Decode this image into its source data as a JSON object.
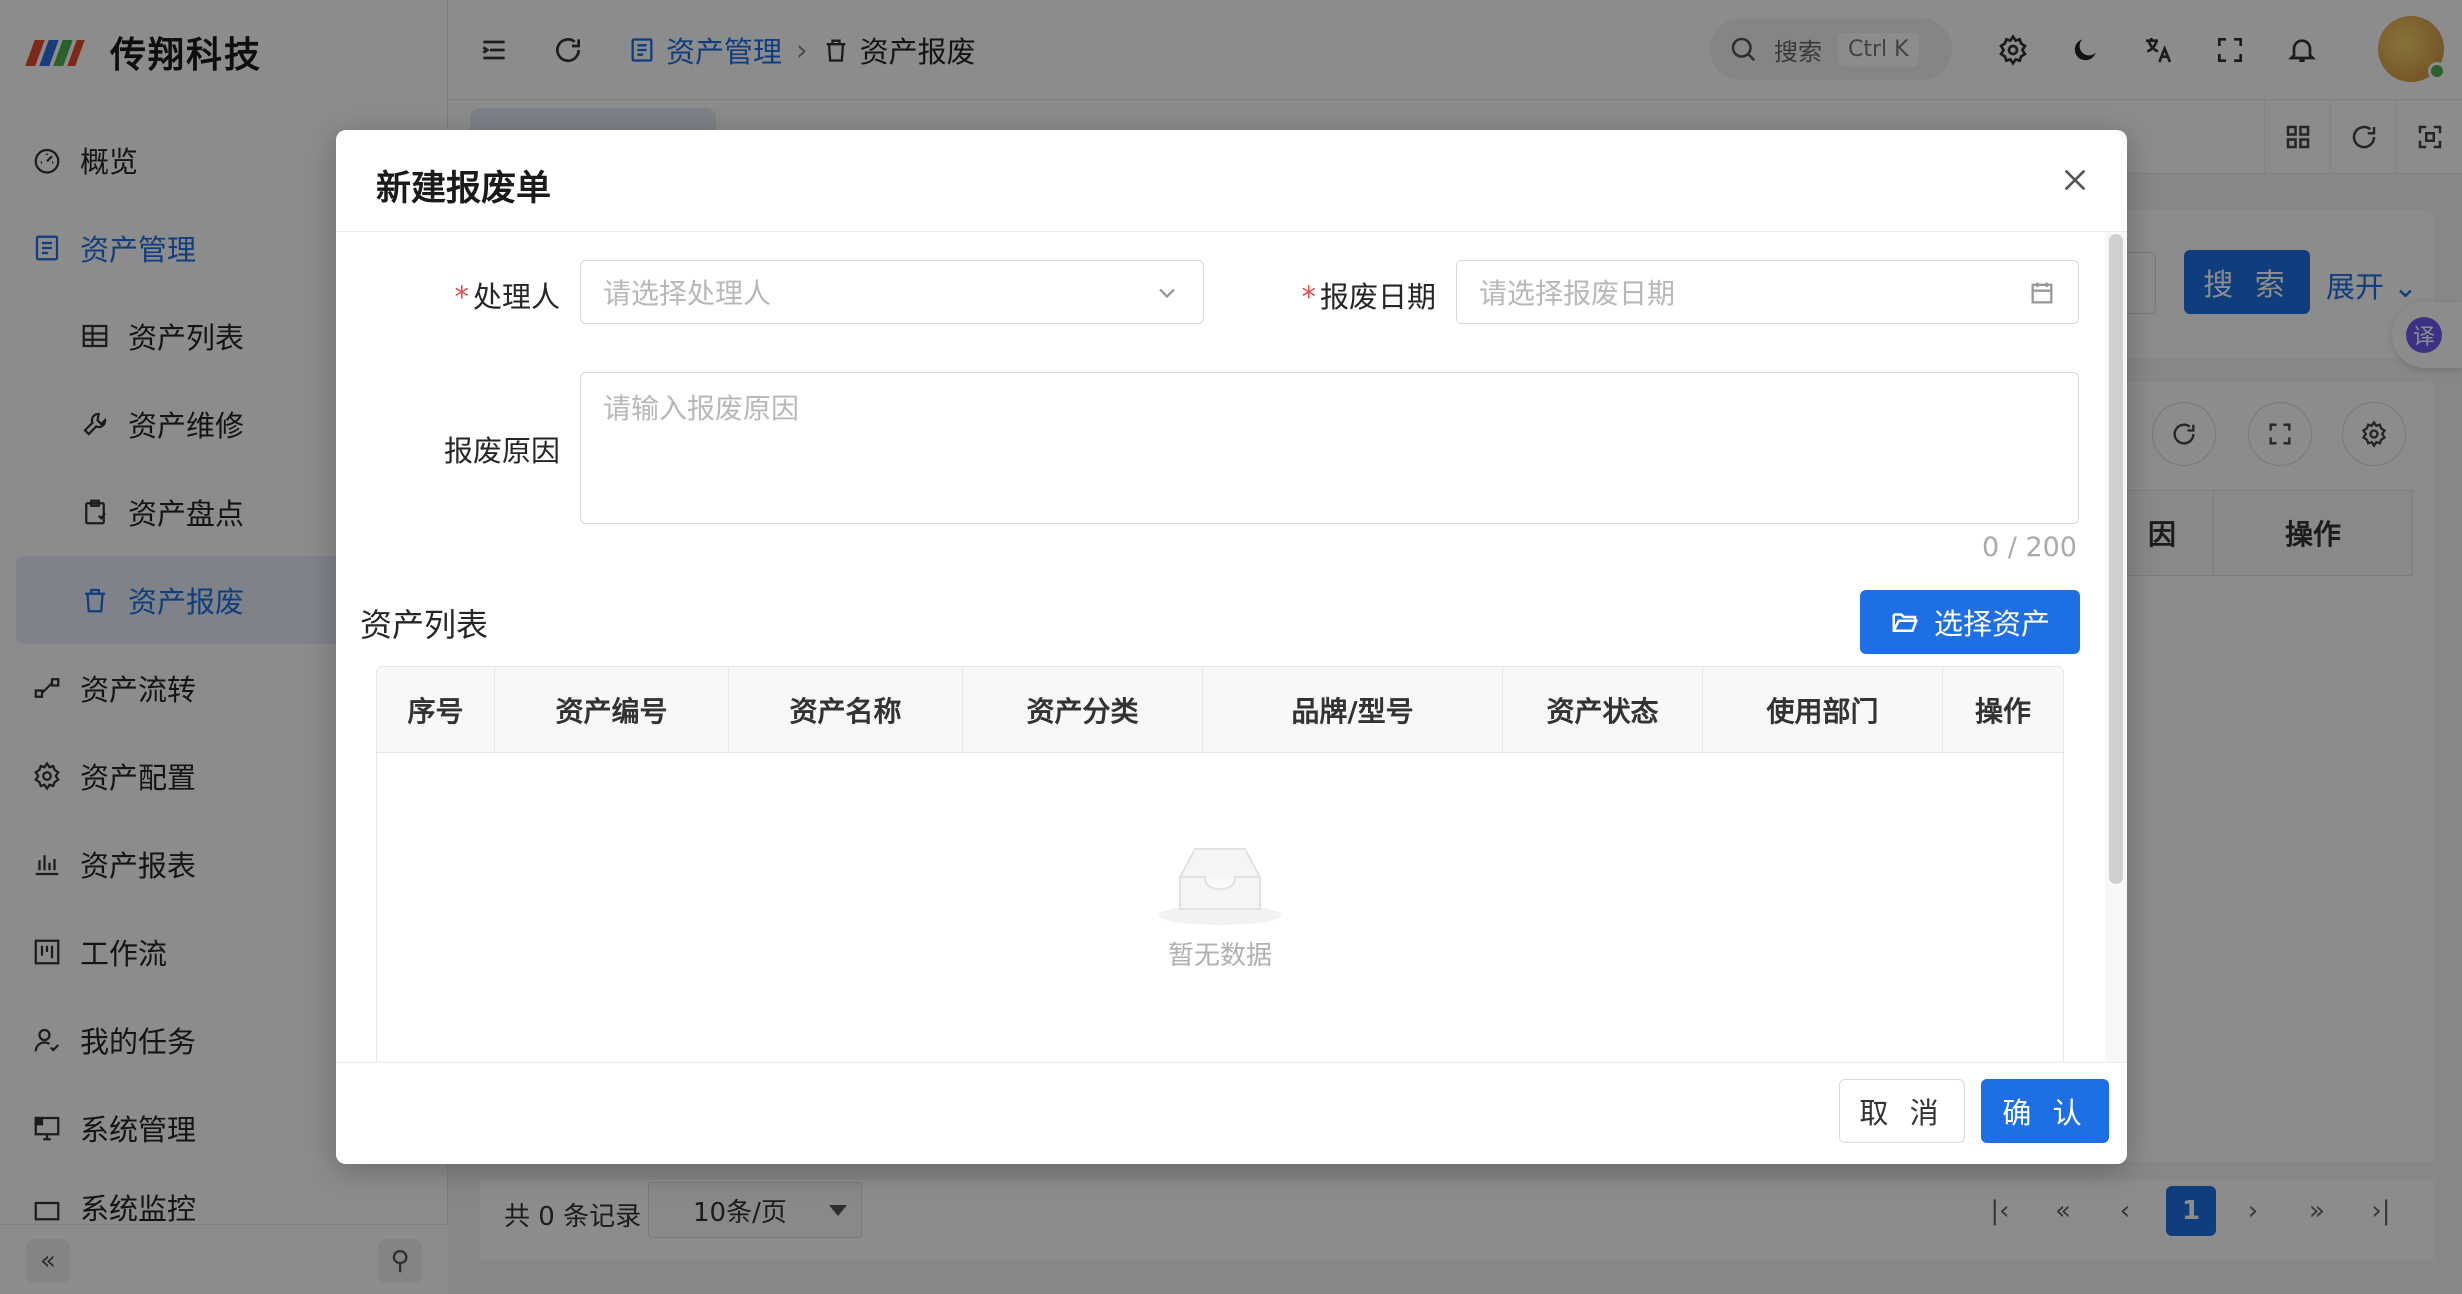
{
  "brand": {
    "name": "传翔科技",
    "logo_colors": [
      "#e64a2e",
      "#2f6fe0",
      "#4caf50",
      "#ffb300"
    ]
  },
  "sidebar": {
    "items": [
      {
        "label": "概览",
        "icon": "dashboard-icon"
      },
      {
        "label": "资产管理",
        "icon": "document-list-icon"
      },
      {
        "label": "资产列表",
        "icon": "table-grid-icon"
      },
      {
        "label": "资产维修",
        "icon": "wrench-icon"
      },
      {
        "label": "资产盘点",
        "icon": "clipboard-icon"
      },
      {
        "label": "资产报废",
        "icon": "trash-icon"
      },
      {
        "label": "资产流转",
        "icon": "flow-icon"
      },
      {
        "label": "资产配置",
        "icon": "gear-icon"
      },
      {
        "label": "资产报表",
        "icon": "bar-chart-icon"
      },
      {
        "label": "工作流",
        "icon": "workflow-icon"
      },
      {
        "label": "我的任务",
        "icon": "user-task-icon"
      },
      {
        "label": "系统管理",
        "icon": "monitor-icon"
      },
      {
        "label": "系统监控",
        "icon": "monitor-chart-icon"
      }
    ],
    "collapse_glyph": "«",
    "pin_glyph": "⚲"
  },
  "header": {
    "breadcrumb": [
      "资产管理",
      "资产报废"
    ],
    "search_placeholder": "搜索",
    "search_shortcut": "Ctrl K"
  },
  "background": {
    "search_button": "搜 索",
    "expand_link": "展开",
    "translate_badge": "译",
    "table_headers": [
      "因",
      "操作"
    ],
    "total_records": "共 0 条记录",
    "page_size": "10条/页",
    "current_page": "1"
  },
  "modal": {
    "title": "新建报废单",
    "form": {
      "handler_label": "处理人",
      "handler_placeholder": "请选择处理人",
      "date_label": "报废日期",
      "date_placeholder": "请选择报废日期",
      "reason_label": "报废原因",
      "reason_placeholder": "请输入报废原因",
      "reason_count": "0 / 200"
    },
    "asset_section_title": "资产列表",
    "select_assets_button": "选择资产",
    "table_columns": [
      "序号",
      "资产编号",
      "资产名称",
      "资产分类",
      "品牌/型号",
      "资产状态",
      "使用部门",
      "操作"
    ],
    "empty_text": "暂无数据",
    "cancel_button": "取 消",
    "confirm_button": "确 认"
  },
  "colors": {
    "primary": "#1e6fe6",
    "required": "#e34d4d"
  }
}
